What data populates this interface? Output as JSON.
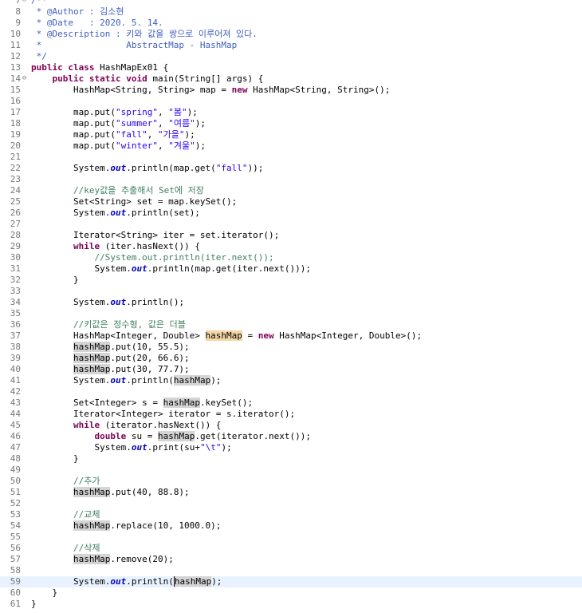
{
  "editor": {
    "lines": [
      {
        "n": "7",
        "t": [
          [
            "jd",
            "/**"
          ]
        ],
        "fold": "⊖"
      },
      {
        "n": "8",
        "t": [
          [
            "jd",
            " * @Author : 김소현"
          ]
        ]
      },
      {
        "n": "9",
        "t": [
          [
            "jd",
            " * @Date   : 2020. 5. 14."
          ]
        ]
      },
      {
        "n": "10",
        "t": [
          [
            "jd",
            " * @Description : 키와 값을 쌍으로 이루어져 있다."
          ]
        ]
      },
      {
        "n": "11",
        "t": [
          [
            "jd",
            " *                AbstractMap - HashMap"
          ]
        ]
      },
      {
        "n": "12",
        "t": [
          [
            "jd",
            " */"
          ]
        ]
      },
      {
        "n": "13",
        "t": [
          [
            "kw",
            "public class"
          ],
          [
            "",
            "HashMapEx01 {"
          ]
        ]
      },
      {
        "n": "14",
        "t": [
          [
            "",
            "    "
          ],
          [
            "kw",
            "public static void"
          ],
          [
            "",
            "main(String[] args) {"
          ]
        ],
        "fold": "⊖"
      },
      {
        "n": "15",
        "t": [
          [
            "",
            "        HashMap<String, String> map = "
          ],
          [
            "kw",
            "new"
          ],
          [
            "",
            "HashMap<String, String>();"
          ]
        ]
      },
      {
        "n": "16",
        "t": []
      },
      {
        "n": "17",
        "t": [
          [
            "",
            "        map.put("
          ],
          [
            "str",
            "\"spring\""
          ],
          [
            "",
            ", "
          ],
          [
            "str",
            "\"봄\""
          ],
          [
            "",
            ");"
          ]
        ]
      },
      {
        "n": "18",
        "t": [
          [
            "",
            "        map.put("
          ],
          [
            "str",
            "\"summer\""
          ],
          [
            "",
            ", "
          ],
          [
            "str",
            "\"여름\""
          ],
          [
            "",
            ");"
          ]
        ]
      },
      {
        "n": "19",
        "t": [
          [
            "",
            "        map.put("
          ],
          [
            "str",
            "\"fall\""
          ],
          [
            "",
            ", "
          ],
          [
            "str",
            "\"가을\""
          ],
          [
            "",
            ");"
          ]
        ]
      },
      {
        "n": "20",
        "t": [
          [
            "",
            "        map.put("
          ],
          [
            "str",
            "\"winter\""
          ],
          [
            "",
            ", "
          ],
          [
            "str",
            "\"겨울\""
          ],
          [
            "",
            ");"
          ]
        ]
      },
      {
        "n": "21",
        "t": []
      },
      {
        "n": "22",
        "t": [
          [
            "",
            "        System."
          ],
          [
            "fld",
            "out"
          ],
          [
            "",
            ".println(map.get("
          ],
          [
            "str",
            "\"fall\""
          ],
          [
            "",
            "));"
          ]
        ]
      },
      {
        "n": "23",
        "t": []
      },
      {
        "n": "24",
        "t": [
          [
            "cm",
            "        //key값을 추출해서 Set에 저장"
          ]
        ]
      },
      {
        "n": "25",
        "t": [
          [
            "",
            "        Set<String> set = map.keySet();"
          ]
        ]
      },
      {
        "n": "26",
        "t": [
          [
            "",
            "        System."
          ],
          [
            "fld",
            "out"
          ],
          [
            "",
            ".println(set);"
          ]
        ]
      },
      {
        "n": "27",
        "t": []
      },
      {
        "n": "28",
        "t": [
          [
            "",
            "        Iterator<String> iter = set.iterator();"
          ]
        ]
      },
      {
        "n": "29",
        "t": [
          [
            "",
            "        "
          ],
          [
            "kw",
            "while"
          ],
          [
            "",
            "(iter.hasNext()) {"
          ]
        ]
      },
      {
        "n": "30",
        "t": [
          [
            "cm",
            "            //System.out.println(iter.next());"
          ]
        ]
      },
      {
        "n": "31",
        "t": [
          [
            "",
            "            System."
          ],
          [
            "fld",
            "out"
          ],
          [
            "",
            ".println(map.get(iter.next()));"
          ]
        ]
      },
      {
        "n": "32",
        "t": [
          [
            "",
            "        }"
          ]
        ]
      },
      {
        "n": "33",
        "t": []
      },
      {
        "n": "34",
        "t": [
          [
            "",
            "        System."
          ],
          [
            "fld",
            "out"
          ],
          [
            "",
            ".println();"
          ]
        ]
      },
      {
        "n": "35",
        "t": []
      },
      {
        "n": "36",
        "t": [
          [
            "cm",
            "        //키값은 정수형, 값은 더블"
          ]
        ]
      },
      {
        "n": "37",
        "t": [
          [
            "",
            "        HashMap<Integer, Double> "
          ],
          [
            "occw",
            "hashMap"
          ],
          [
            "",
            " = "
          ],
          [
            "kw",
            "new"
          ],
          [
            "",
            "HashMap<Integer, Double>();"
          ]
        ]
      },
      {
        "n": "38",
        "t": [
          [
            "",
            "        "
          ],
          [
            "occ",
            "hashMap"
          ],
          [
            "",
            ".put(10, 55.5);"
          ]
        ]
      },
      {
        "n": "39",
        "t": [
          [
            "",
            "        "
          ],
          [
            "occ",
            "hashMap"
          ],
          [
            "",
            ".put(20, 66.6);"
          ]
        ]
      },
      {
        "n": "40",
        "t": [
          [
            "",
            "        "
          ],
          [
            "occ",
            "hashMap"
          ],
          [
            "",
            ".put(30, 77.7);"
          ]
        ]
      },
      {
        "n": "41",
        "t": [
          [
            "",
            "        System."
          ],
          [
            "fld",
            "out"
          ],
          [
            "",
            ".println("
          ],
          [
            "occ",
            "hashMap"
          ],
          [
            "",
            ");"
          ]
        ]
      },
      {
        "n": "42",
        "t": []
      },
      {
        "n": "43",
        "t": [
          [
            "",
            "        Set<Integer> s = "
          ],
          [
            "occ",
            "hashMap"
          ],
          [
            "",
            ".keySet();"
          ]
        ]
      },
      {
        "n": "44",
        "t": [
          [
            "",
            "        Iterator<Integer> iterator = s.iterator();"
          ]
        ]
      },
      {
        "n": "45",
        "t": [
          [
            "",
            "        "
          ],
          [
            "kw",
            "while"
          ],
          [
            "",
            "(iterator.hasNext()) {"
          ]
        ]
      },
      {
        "n": "46",
        "t": [
          [
            "",
            "            "
          ],
          [
            "kw",
            "double"
          ],
          [
            "",
            " su = "
          ],
          [
            "occ",
            "hashMap"
          ],
          [
            "",
            ".get(iterator.next());"
          ]
        ]
      },
      {
        "n": "47",
        "t": [
          [
            "",
            "            System."
          ],
          [
            "fld",
            "out"
          ],
          [
            "",
            ".print(su+"
          ],
          [
            "str",
            "\"\\t\""
          ],
          [
            "",
            ");"
          ]
        ]
      },
      {
        "n": "48",
        "t": [
          [
            "",
            "        }"
          ]
        ]
      },
      {
        "n": "49",
        "t": []
      },
      {
        "n": "50",
        "t": [
          [
            "cm",
            "        //추가"
          ]
        ]
      },
      {
        "n": "51",
        "t": [
          [
            "",
            "        "
          ],
          [
            "occ",
            "hashMap"
          ],
          [
            "",
            ".put(40, 88.8);"
          ]
        ]
      },
      {
        "n": "52",
        "t": []
      },
      {
        "n": "53",
        "t": [
          [
            "cm",
            "        //교체"
          ]
        ]
      },
      {
        "n": "54",
        "t": [
          [
            "",
            "        "
          ],
          [
            "occ",
            "hashMap"
          ],
          [
            "",
            ".replace(10, 1000.0);"
          ]
        ]
      },
      {
        "n": "55",
        "t": []
      },
      {
        "n": "56",
        "t": [
          [
            "cm",
            "        //삭제"
          ]
        ]
      },
      {
        "n": "57",
        "t": [
          [
            "",
            "        "
          ],
          [
            "occ",
            "hashMap"
          ],
          [
            "",
            ".remove(20);"
          ]
        ]
      },
      {
        "n": "58",
        "t": []
      },
      {
        "n": "59",
        "t": [
          [
            "",
            "        System."
          ],
          [
            "fld",
            "out"
          ],
          [
            "",
            ".println("
          ],
          [
            "occ",
            "hashMap"
          ],
          [
            "",
            ");"
          ]
        ],
        "current": true
      },
      {
        "n": "60",
        "t": [
          [
            "",
            "    }"
          ]
        ]
      },
      {
        "n": "61",
        "t": [
          [
            "",
            "}"
          ]
        ]
      }
    ]
  },
  "colors": {
    "keyword": "#7f0055",
    "string": "#2a00ff",
    "comment": "#3f7f5f",
    "javadoc": "#3f5fbf",
    "field": "#0000c0",
    "occurrence": "#d4d4d4",
    "occurrence_write": "#f5d6a7",
    "current_line": "#e8f2fe"
  },
  "icons": {
    "fold": "collapse-icon"
  }
}
